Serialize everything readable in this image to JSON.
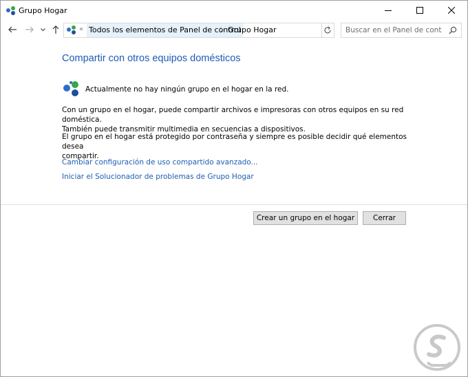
{
  "window": {
    "title": "Grupo Hogar"
  },
  "nav": {
    "address_overflow": "«",
    "breadcrumbs": [
      "Todos los elementos de Panel de control",
      "Grupo Hogar"
    ],
    "search_placeholder": "Buscar en el Panel de control"
  },
  "content": {
    "heading": "Compartir con otros equipos domésticos",
    "status": "Actualmente no hay ningún grupo en el hogar en la red.",
    "para1_line1": "Con un grupo en el hogar, puede compartir archivos e impresoras con otros equipos en su red doméstica.",
    "para1_line2": "También puede transmitir multimedia en secuencias a dispositivos.",
    "para2_line1": "El grupo en el hogar está protegido por contraseña y siempre es posible decidir qué elementos desea",
    "para2_line2": "compartir.",
    "link_advanced": "Cambiar configuración de uso compartido avanzado...",
    "link_troubleshooter": "Iniciar el Solucionador de problemas de Grupo Hogar"
  },
  "buttons": {
    "create": "Crear un grupo en el hogar",
    "close": "Cerrar"
  },
  "colors": {
    "accent": "#1e5cb3",
    "button_bg": "#e1e1e1",
    "crumb_highlight": "#e5f1fb"
  },
  "icons": [
    "homegroup-icon",
    "minimize-icon",
    "maximize-icon",
    "close-icon",
    "back-arrow-icon",
    "forward-arrow-icon",
    "recent-chevron-icon",
    "up-arrow-icon",
    "refresh-icon",
    "search-icon"
  ]
}
